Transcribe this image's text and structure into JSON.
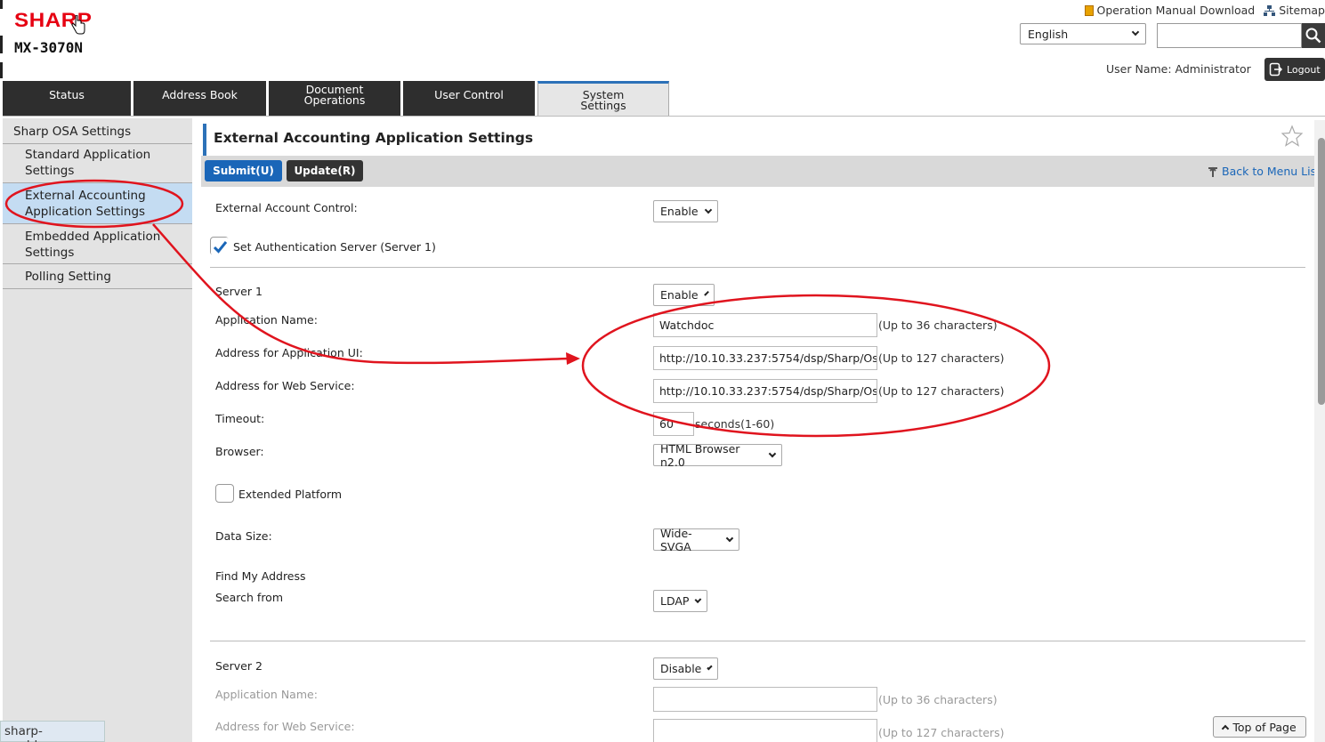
{
  "header": {
    "brand": "SHARP",
    "model": "MX-3070N",
    "operation_manual": "Operation Manual Download",
    "sitemap": "Sitemap",
    "language": "English",
    "search_value": "",
    "username": "User Name: Administrator",
    "logout": "Logout"
  },
  "tabs": [
    {
      "label": "Status"
    },
    {
      "label": "Address Book"
    },
    {
      "label": "Document Operations"
    },
    {
      "label": "User Control"
    },
    {
      "label": "System Settings"
    }
  ],
  "sidebar": {
    "items": [
      {
        "label": "Sharp OSA Settings"
      },
      {
        "label": "Standard Application Settings"
      },
      {
        "label": "External Accounting Application Settings"
      },
      {
        "label": "Embedded Application Settings"
      },
      {
        "label": "Polling Setting"
      }
    ]
  },
  "status_url": "sharp-world.com",
  "page": {
    "title": "External Accounting Application Settings",
    "submit": "Submit(U)",
    "update": "Update(R)",
    "back": "Back to Menu List",
    "top_of_page": "Top of Page"
  },
  "form": {
    "ext_control_label": "External Account Control:",
    "ext_control_value": "Enable",
    "set_auth_label": "Set Authentication Server (Server 1)",
    "server1_label": "Server 1",
    "server1_value": "Enable",
    "app_name_label": "Application Name:",
    "app_name_value": "Watchdoc",
    "app_name_hint": "(Up to 36 characters)",
    "addr_ui_label": "Address for Application UI:",
    "addr_ui_value": "http://10.10.33.237:5754/dsp/Sharp/Os",
    "addr_ui_hint": "(Up to 127 characters)",
    "addr_ws_label": "Address for Web Service:",
    "addr_ws_value": "http://10.10.33.237:5754/dsp/Sharp/Os",
    "addr_ws_hint": "(Up to 127 characters)",
    "timeout_label": "Timeout:",
    "timeout_value": "60",
    "timeout_hint": "seconds(1-60)",
    "browser_label": "Browser:",
    "browser_value": "HTML Browser n2.0",
    "ext_platform_label": "Extended Platform",
    "data_size_label": "Data Size:",
    "data_size_value": "Wide-SVGA",
    "find_addr_label": "Find My Address",
    "search_from_label": "Search from",
    "search_from_value": "LDAP",
    "server2_label": "Server 2",
    "server2_value": "Disable",
    "s2_app_name_label": "Application Name:",
    "s2_app_name_hint": "(Up to 36 characters)",
    "s2_addr_ws_label": "Address for Web Service:",
    "s2_addr_ws_hint": "(Up to 127 characters)"
  },
  "colors": {
    "brand_red": "#e60012",
    "accent_blue": "#2c71b8",
    "annotation_red": "#e0141e",
    "selected_bg": "#c4dcf2"
  }
}
